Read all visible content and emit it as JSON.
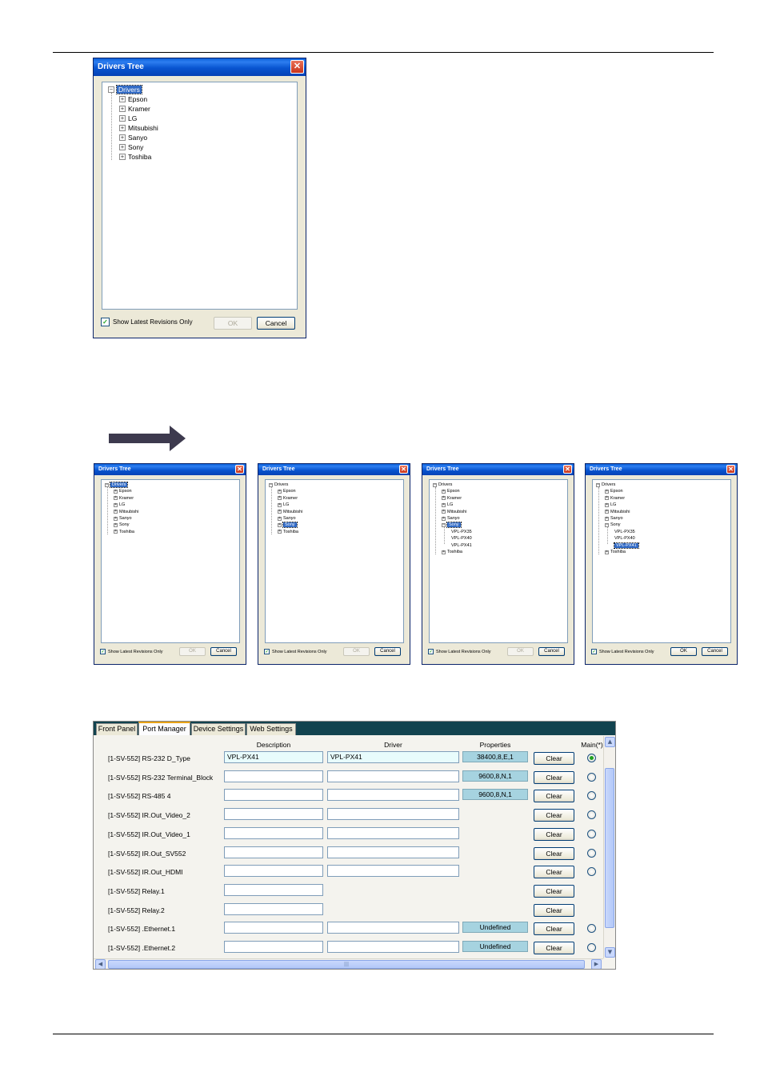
{
  "dialog": {
    "title": "Drivers Tree",
    "close_glyph": "✕",
    "root": "Drivers",
    "manufacturers": [
      "Epson",
      "Kramer",
      "LG",
      "Mitsubishi",
      "Sanyo",
      "Sony",
      "Toshiba"
    ],
    "sony_models": [
      "VPL-PX35",
      "VPL-PX40",
      "VPL-PX41"
    ],
    "show_latest_label": "Show Latest Revisions Only",
    "show_latest_checked": true,
    "ok_label": "OK",
    "cancel_label": "Cancel",
    "check_glyph": "✓",
    "expand_glyph": "+",
    "collapse_glyph": "−"
  },
  "steps": [
    {
      "selected": "Drivers",
      "sony_expanded": false,
      "ok_enabled": false
    },
    {
      "selected": "Sony",
      "sony_expanded": false,
      "ok_enabled": false
    },
    {
      "selected": "Sony",
      "sony_expanded": true,
      "ok_enabled": false
    },
    {
      "selected": "VPL-PX41",
      "sony_expanded": true,
      "ok_enabled": true
    }
  ],
  "colors": {
    "title_bar": "#0854d0",
    "selection": "#316ac5",
    "arrow": "#3d3a4e",
    "property_fill": "#a6d3e0",
    "tab_bar": "#12434f"
  },
  "port_manager": {
    "tabs": [
      "Front Panel",
      "Port Manager",
      "Device Settings",
      "Web Settings"
    ],
    "active_tab": "Port Manager",
    "columns": {
      "description": "Description",
      "driver": "Driver",
      "properties": "Properties",
      "main": "Main(*)"
    },
    "clear_label": "Clear",
    "rows": [
      {
        "port": "[1-SV-552] RS-232 D_Type",
        "description": "VPL-PX41",
        "driver": "VPL-PX41",
        "properties": "38400,8,E,1",
        "has_driver": true,
        "has_radio": true,
        "main": true
      },
      {
        "port": "[1-SV-552] RS-232 Terminal_Block",
        "description": "",
        "driver": "",
        "properties": "9600,8,N,1",
        "has_driver": true,
        "has_radio": true,
        "main": false
      },
      {
        "port": "[1-SV-552] RS-485 4",
        "description": "",
        "driver": "",
        "properties": "9600,8,N,1",
        "has_driver": true,
        "has_radio": true,
        "main": false
      },
      {
        "port": "[1-SV-552] IR.Out_Video_2",
        "description": "",
        "driver": "",
        "properties": "",
        "has_driver": true,
        "has_radio": true,
        "main": false
      },
      {
        "port": "[1-SV-552] IR.Out_Video_1",
        "description": "",
        "driver": "",
        "properties": "",
        "has_driver": true,
        "has_radio": true,
        "main": false
      },
      {
        "port": "[1-SV-552] IR.Out_SV552",
        "description": "",
        "driver": "",
        "properties": "",
        "has_driver": true,
        "has_radio": true,
        "main": false
      },
      {
        "port": "[1-SV-552] IR.Out_HDMI",
        "description": "",
        "driver": "",
        "properties": "",
        "has_driver": true,
        "has_radio": true,
        "main": false
      },
      {
        "port": "[1-SV-552] Relay.1",
        "description": "",
        "driver": "",
        "properties": "",
        "has_driver": false,
        "has_radio": false,
        "main": false
      },
      {
        "port": "[1-SV-552] Relay.2",
        "description": "",
        "driver": "",
        "properties": "",
        "has_driver": false,
        "has_radio": false,
        "main": false
      },
      {
        "port": "[1-SV-552] .Ethernet.1",
        "description": "",
        "driver": "",
        "properties": "Undefined",
        "has_driver": true,
        "has_radio": true,
        "main": false
      },
      {
        "port": "[1-SV-552] .Ethernet.2",
        "description": "",
        "driver": "",
        "properties": "Undefined",
        "has_driver": true,
        "has_radio": true,
        "main": false
      }
    ],
    "scroll_up_glyph": "▲",
    "scroll_down_glyph": "▼",
    "scroll_left_glyph": "◀",
    "scroll_right_glyph": "▶",
    "grip_glyph": "|||"
  }
}
